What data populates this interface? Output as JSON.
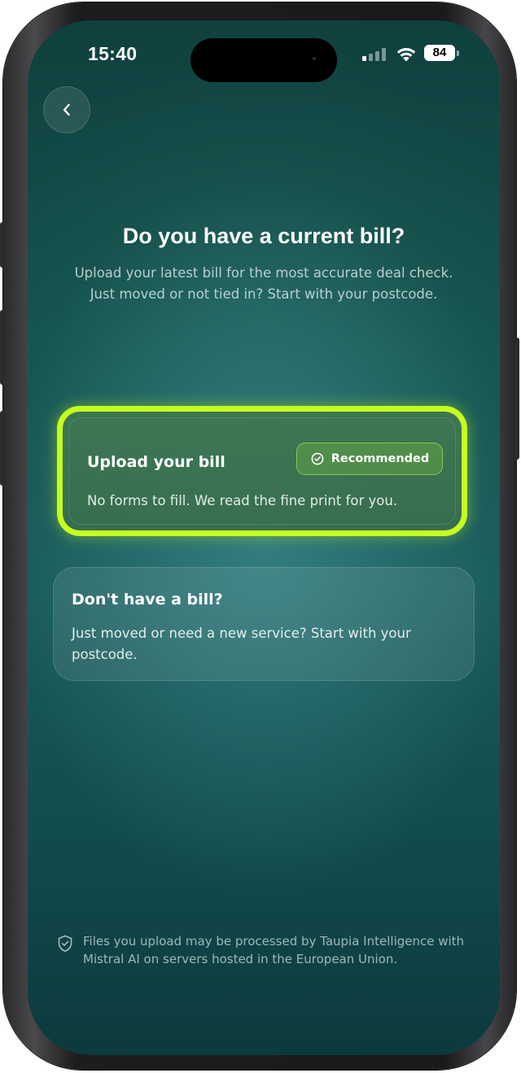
{
  "status_bar": {
    "time": "15:40",
    "battery": "84"
  },
  "header": {
    "title": "Do you have a current bill?",
    "subtitle": "Upload your latest bill for the most accurate deal check. Just moved or not tied in? Start with your postcode."
  },
  "options": {
    "upload": {
      "title": "Upload your bill",
      "badge": "Recommended",
      "description": "No forms to fill. We read the fine print for you."
    },
    "no_bill": {
      "title": "Don't have a bill?",
      "description": "Just moved or need a new service? Start with your postcode."
    }
  },
  "footer": {
    "disclaimer": "Files you upload may be processed by Taupia Intelligence with Mistral AI on servers hosted in the European Union."
  },
  "colors": {
    "accent_highlight": "#c6ff1f",
    "background": "#155550"
  },
  "icons": {
    "back": "chevron-left-icon",
    "badge": "check-circle-icon",
    "disclaimer": "shield-check-icon"
  }
}
